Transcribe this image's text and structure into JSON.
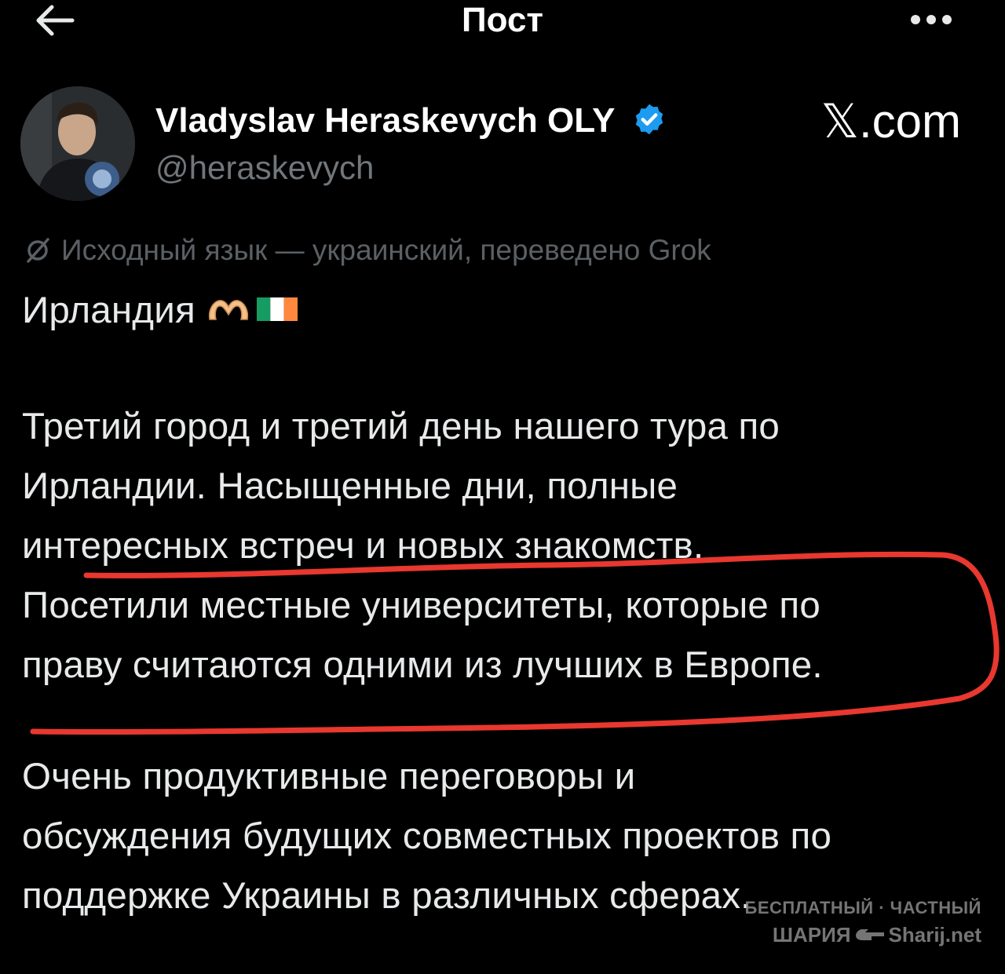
{
  "header": {
    "title": "Пост",
    "back_icon": "arrow-left-icon",
    "more_icon": "more-horizontal-icon"
  },
  "author": {
    "name": "Vladyslav Heraskevych OLY",
    "handle": "@heraskevych",
    "verified_icon": "verified-badge-icon",
    "verified_color": "#1d9bf0"
  },
  "brand": "𝕏.com",
  "translation_note": "Исходный язык — украинский, переведено Grok",
  "post": {
    "line1": "Ирландия",
    "paragraph2": [
      "Третий город и третий день нашего тура по",
      "Ирландии. Насыщенные дни, полные",
      "интересных встреч и новых знакомств.",
      "Посетили местные университеты, которые по",
      "праву считаются одними из лучших в Европе."
    ],
    "paragraph3": [
      "Очень продуктивные переговоры и",
      "обсуждения будущих совместных проектов по",
      "поддержке Украины в различных сферах."
    ]
  },
  "annotation_color": "#e8382f",
  "watermark": {
    "line1": "БЕСПЛАТНЫЙ · ЧАСТНЫЙ",
    "line2_left": "ШАРИЯ",
    "line2_right": "Sharij.net"
  }
}
